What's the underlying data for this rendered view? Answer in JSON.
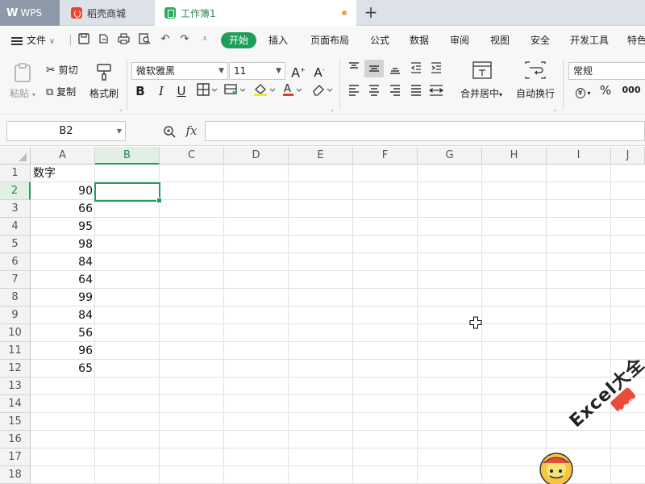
{
  "titlebar": {
    "tabs": [
      {
        "label": "WPS",
        "logo": "W"
      },
      {
        "label": "稻壳商城"
      },
      {
        "label": "工作簿1"
      }
    ]
  },
  "menubar": {
    "file_label": "文件",
    "items": [
      "开始",
      "插入",
      "页面布局",
      "公式",
      "数据",
      "审阅",
      "视图",
      "安全",
      "开发工具",
      "特色"
    ],
    "active": "开始"
  },
  "ribbon": {
    "paste": "粘贴",
    "cut": "剪切",
    "copy": "复制",
    "format_painter": "格式刷",
    "font_name": "微软雅黑",
    "font_size": "11",
    "merge_center": "合并居中",
    "wrap_text": "自动换行",
    "number_format": "常规"
  },
  "formula_bar": {
    "name_box": "B2",
    "fx_label": "fx",
    "formula": ""
  },
  "sheet": {
    "columns": [
      "A",
      "B",
      "C",
      "D",
      "E",
      "F",
      "G",
      "H",
      "I",
      "J"
    ],
    "rows": [
      "1",
      "2",
      "3",
      "4",
      "5",
      "6",
      "7",
      "8",
      "9",
      "10",
      "11",
      "12",
      "13",
      "14",
      "15",
      "16",
      "17",
      "18"
    ],
    "selected_cell": "B2",
    "header_cell": "数字",
    "values": [
      "90",
      "66",
      "95",
      "98",
      "84",
      "64",
      "99",
      "84",
      "56",
      "96",
      "65"
    ]
  },
  "watermark": {
    "text": "Excel大全",
    "badge": "头条号"
  },
  "colors": {
    "accent": "#1f9e5a",
    "tab_active_text": "#2d8a4e"
  }
}
